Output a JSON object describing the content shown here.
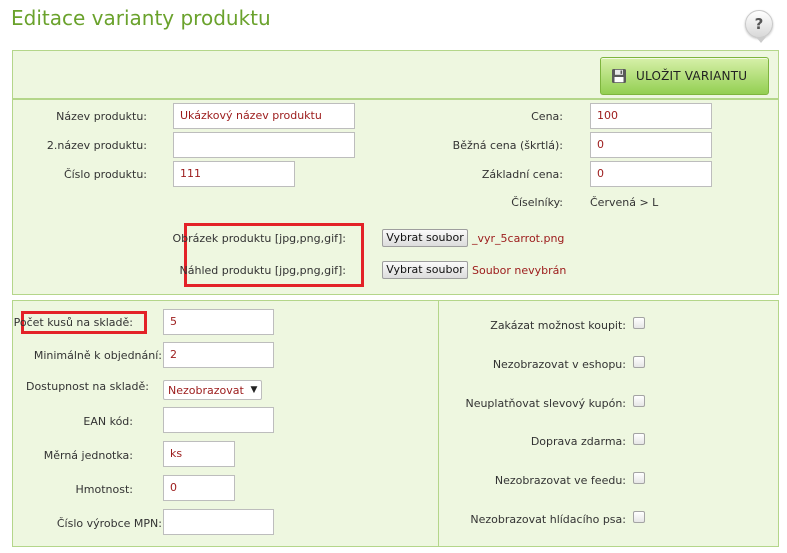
{
  "page": {
    "title": "Editace varianty produktu"
  },
  "help": {
    "symbol": "?"
  },
  "toolbar": {
    "save_label": "ULOŽIT VARIANTU"
  },
  "product": {
    "name_label": "Název produktu:",
    "name_value": "Ukázkový název produktu",
    "name2_label": "2.název produktu:",
    "name2_value": "",
    "number_label": "Číslo produktu:",
    "number_value": "111",
    "price_label": "Cena:",
    "price_value": "100",
    "regular_price_label": "Běžná cena (škrtlá):",
    "regular_price_value": "0",
    "base_price_label": "Základní cena:",
    "base_price_value": "0",
    "codelists_label": "Číselníky:",
    "codelists_value": "Červená > L",
    "image_label": "Obrázek produktu [jpg,png,gif]:",
    "image_button": "Vybrat soubor",
    "image_file": "_vyr_5carrot.png",
    "preview_label": "Náhled produktu [jpg,png,gif]:",
    "preview_button": "Vybrat soubor",
    "preview_file": "Soubor nevybrán"
  },
  "stock": {
    "count_label": "Počet kusů na skladě:",
    "count_value": "5",
    "min_order_label": "Minimálně k objednání:",
    "min_order_value": "2",
    "availability_label": "Dostupnost na skladě:",
    "availability_value": "Nezobrazovat d",
    "ean_label": "EAN kód:",
    "ean_value": "",
    "unit_label": "Měrná jednotka:",
    "unit_value": "ks",
    "weight_label": "Hmotnost:",
    "weight_value": "0",
    "mpn_label": "Číslo výrobce MPN:",
    "mpn_value": ""
  },
  "options": [
    {
      "label": "Zakázat možnost koupit:",
      "checked": false
    },
    {
      "label": "Nezobrazovat v eshopu:",
      "checked": false
    },
    {
      "label": "Neuplatňovat slevový kupón:",
      "checked": false
    },
    {
      "label": "Doprava zdarma:",
      "checked": false
    },
    {
      "label": "Nezobrazovat ve feedu:",
      "checked": false
    },
    {
      "label": "Nezobrazovat hlídacího psa:",
      "checked": false
    }
  ]
}
